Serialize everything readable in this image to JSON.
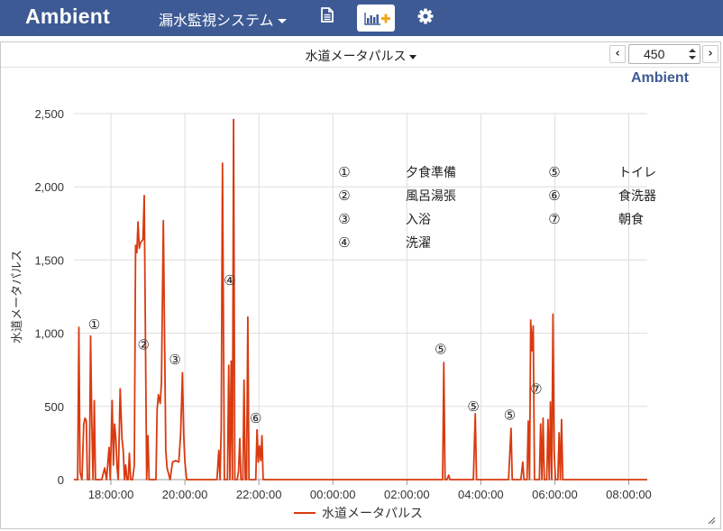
{
  "navbar": {
    "brand": "Ambient",
    "system_menu": "漏水監視システム",
    "icons": [
      "document-icon",
      "add-chart-icon",
      "gear-icon"
    ]
  },
  "toolbar": {
    "chart_selector": "水道メータパルス",
    "points_value": "450",
    "prev": "‹",
    "next": "›"
  },
  "credit": "Ambient",
  "legend_box": {
    "items": [
      {
        "mark": "①",
        "label": "夕食準備"
      },
      {
        "mark": "②",
        "label": "風呂湯張"
      },
      {
        "mark": "③",
        "label": "入浴"
      },
      {
        "mark": "④",
        "label": "洗濯"
      },
      {
        "mark": "⑤",
        "label": "トイレ"
      },
      {
        "mark": "⑥",
        "label": "食洗器"
      },
      {
        "mark": "⑦",
        "label": "朝食"
      }
    ]
  },
  "chart_data": {
    "type": "line",
    "title": "",
    "xlabel": "",
    "ylabel": "水道メータパルス",
    "ylim": [
      0,
      2500
    ],
    "yticks": [
      0,
      500,
      1000,
      1500,
      2000,
      2500
    ],
    "ytick_labels": [
      "0",
      "500",
      "1,000",
      "1,500",
      "2,000",
      "2,500"
    ],
    "x_range_hours": [
      17.0,
      8.5
    ],
    "xticks": [
      "18:00:00",
      "20:00:00",
      "22:00:00",
      "00:00:00",
      "02:00:00",
      "04:00:00",
      "06:00:00",
      "08:00:00"
    ],
    "grid": true,
    "color": "#d93a0f",
    "legend_position": "bottom",
    "series": [
      {
        "name": "水道メータパルス",
        "points": [
          [
            "17:00",
            0
          ],
          [
            "17:06",
            0
          ],
          [
            "17:08",
            1040
          ],
          [
            "17:10",
            50
          ],
          [
            "17:13",
            0
          ],
          [
            "17:16",
            380
          ],
          [
            "17:18",
            420
          ],
          [
            "17:20",
            400
          ],
          [
            "17:22",
            0
          ],
          [
            "17:25",
            0
          ],
          [
            "17:27",
            980
          ],
          [
            "17:29",
            400
          ],
          [
            "17:31",
            0
          ],
          [
            "17:33",
            540
          ],
          [
            "17:35",
            0
          ],
          [
            "17:45",
            0
          ],
          [
            "17:50",
            80
          ],
          [
            "17:53",
            0
          ],
          [
            "17:57",
            220
          ],
          [
            "17:59",
            0
          ],
          [
            "18:02",
            540
          ],
          [
            "18:04",
            100
          ],
          [
            "18:06",
            380
          ],
          [
            "18:08",
            280
          ],
          [
            "18:10",
            80
          ],
          [
            "18:12",
            0
          ],
          [
            "18:15",
            620
          ],
          [
            "18:18",
            280
          ],
          [
            "18:20",
            200
          ],
          [
            "18:22",
            0
          ],
          [
            "18:24",
            100
          ],
          [
            "18:26",
            0
          ],
          [
            "18:28",
            0
          ],
          [
            "18:30",
            180
          ],
          [
            "18:32",
            0
          ],
          [
            "18:35",
            0
          ],
          [
            "18:38",
            100
          ],
          [
            "18:40",
            1600
          ],
          [
            "18:42",
            1550
          ],
          [
            "18:44",
            1760
          ],
          [
            "18:46",
            1580
          ],
          [
            "18:48",
            1620
          ],
          [
            "18:52",
            1640
          ],
          [
            "18:54",
            1940
          ],
          [
            "18:56",
            1000
          ],
          [
            "18:58",
            0
          ],
          [
            "19:00",
            300
          ],
          [
            "19:02",
            0
          ],
          [
            "19:05",
            0
          ],
          [
            "19:10",
            0
          ],
          [
            "19:13",
            0
          ],
          [
            "19:15",
            480
          ],
          [
            "19:17",
            580
          ],
          [
            "19:20",
            520
          ],
          [
            "19:22",
            660
          ],
          [
            "19:25",
            1770
          ],
          [
            "19:27",
            1000
          ],
          [
            "19:29",
            200
          ],
          [
            "19:31",
            80
          ],
          [
            "19:36",
            0
          ],
          [
            "19:40",
            120
          ],
          [
            "19:45",
            130
          ],
          [
            "19:50",
            120
          ],
          [
            "19:53",
            300
          ],
          [
            "19:56",
            730
          ],
          [
            "19:58",
            320
          ],
          [
            "20:00",
            120
          ],
          [
            "20:03",
            0
          ],
          [
            "20:15",
            0
          ],
          [
            "20:30",
            0
          ],
          [
            "20:45",
            0
          ],
          [
            "20:52",
            0
          ],
          [
            "20:55",
            200
          ],
          [
            "20:57",
            0
          ],
          [
            "20:59",
            350
          ],
          [
            "21:01",
            2160
          ],
          [
            "21:04",
            0
          ],
          [
            "21:09",
            0
          ],
          [
            "21:11",
            780
          ],
          [
            "21:13",
            0
          ],
          [
            "21:15",
            810
          ],
          [
            "21:17",
            0
          ],
          [
            "21:19",
            2460
          ],
          [
            "21:21",
            0
          ],
          [
            "21:25",
            0
          ],
          [
            "21:27",
            60
          ],
          [
            "21:29",
            280
          ],
          [
            "21:31",
            0
          ],
          [
            "21:34",
            0
          ],
          [
            "21:36",
            680
          ],
          [
            "21:38",
            0
          ],
          [
            "21:40",
            0
          ],
          [
            "21:42",
            1110
          ],
          [
            "21:44",
            0
          ],
          [
            "21:48",
            0
          ],
          [
            "21:52",
            0
          ],
          [
            "21:55",
            0
          ],
          [
            "21:57",
            340
          ],
          [
            "21:59",
            120
          ],
          [
            "22:01",
            230
          ],
          [
            "22:03",
            130
          ],
          [
            "22:05",
            300
          ],
          [
            "22:07",
            0
          ],
          [
            "22:30",
            0
          ],
          [
            "23:00",
            0
          ],
          [
            "0:00",
            0
          ],
          [
            "1:00",
            0
          ],
          [
            "2:00",
            0
          ],
          [
            "2:58",
            0
          ],
          [
            "3:00",
            800
          ],
          [
            "3:02",
            0
          ],
          [
            "3:05",
            0
          ],
          [
            "3:08",
            30
          ],
          [
            "3:10",
            0
          ],
          [
            "3:30",
            0
          ],
          [
            "3:48",
            0
          ],
          [
            "3:51",
            450
          ],
          [
            "3:53",
            0
          ],
          [
            "4:30",
            0
          ],
          [
            "4:45",
            0
          ],
          [
            "4:49",
            350
          ],
          [
            "4:51",
            0
          ],
          [
            "5:05",
            0
          ],
          [
            "5:08",
            120
          ],
          [
            "5:10",
            0
          ],
          [
            "5:15",
            0
          ],
          [
            "5:17",
            400
          ],
          [
            "5:19",
            0
          ],
          [
            "5:21",
            1090
          ],
          [
            "5:23",
            880
          ],
          [
            "5:25",
            1050
          ],
          [
            "5:27",
            0
          ],
          [
            "5:35",
            0
          ],
          [
            "5:37",
            380
          ],
          [
            "5:39",
            0
          ],
          [
            "5:41",
            420
          ],
          [
            "5:43",
            0
          ],
          [
            "5:47",
            0
          ],
          [
            "5:49",
            410
          ],
          [
            "5:51",
            0
          ],
          [
            "5:53",
            530
          ],
          [
            "5:55",
            0
          ],
          [
            "5:57",
            1130
          ],
          [
            "5:59",
            200
          ],
          [
            "6:01",
            0
          ],
          [
            "6:05",
            0
          ],
          [
            "6:07",
            320
          ],
          [
            "6:09",
            0
          ],
          [
            "6:11",
            410
          ],
          [
            "6:13",
            0
          ],
          [
            "6:20",
            0
          ],
          [
            "6:30",
            0
          ],
          [
            "7:00",
            0
          ],
          [
            "8:30",
            0
          ]
        ]
      }
    ],
    "annotations": [
      {
        "mark": "①",
        "time": "17:33",
        "value": 1060
      },
      {
        "mark": "②",
        "time": "18:53",
        "value": 920
      },
      {
        "mark": "③",
        "time": "19:44",
        "value": 820
      },
      {
        "mark": "④",
        "time": "21:13",
        "value": 1360
      },
      {
        "mark": "⑥",
        "time": "21:55",
        "value": 420
      },
      {
        "mark": "⑤",
        "time": "2:55",
        "value": 890
      },
      {
        "mark": "⑤",
        "time": "3:48",
        "value": 500
      },
      {
        "mark": "⑤",
        "time": "4:47",
        "value": 440
      },
      {
        "mark": "⑦",
        "time": "5:30",
        "value": 620
      }
    ]
  }
}
